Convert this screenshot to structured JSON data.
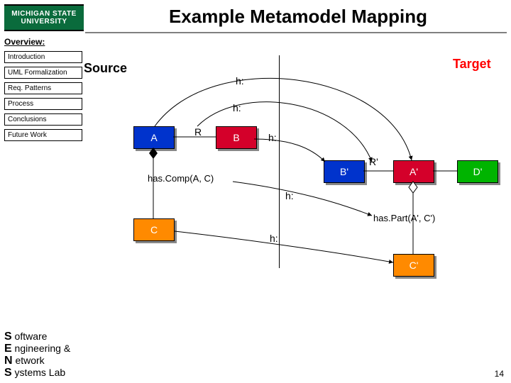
{
  "logo": "MICHIGAN STATE\nUNIVERSITY",
  "title": "Example Metamodel Mapping",
  "overview_label": "Overview:",
  "sidebar": {
    "items": [
      {
        "label": "Introduction"
      },
      {
        "label": "UML Formalization"
      },
      {
        "label": "Req. Patterns"
      },
      {
        "label": "Process"
      },
      {
        "label": "Conclusions"
      },
      {
        "label": "Future Work"
      }
    ]
  },
  "diagram": {
    "source_label": "Source",
    "target_label": "Target",
    "arc_labels": {
      "h1": "h:",
      "h2": "h:",
      "h3": "h:",
      "h4": "h:",
      "h5": "h:"
    },
    "source_nodes": {
      "A": "A",
      "B": "B",
      "C": "C",
      "R": "R"
    },
    "target_nodes": {
      "Ap": "A'",
      "Bp": "B'",
      "Cp": "C'",
      "Dp": "D'",
      "Rp": "R'"
    },
    "source_rel": "has.Comp(A, C)",
    "target_rel": "has.Part(A', C')"
  },
  "footer": {
    "l1_cap": "S",
    "l1": " oftware",
    "l2_cap": "E",
    "l2": " ngineering &",
    "l3_cap": "N",
    "l3": " etwork",
    "l4_cap": "S",
    "l4": " ystems Lab"
  },
  "page_number": "14",
  "colors": {
    "green_box": "#0a6b3c",
    "blue": "#0033cc",
    "red": "#d4002a",
    "green": "#00b400",
    "orange": "#ff8a00"
  }
}
